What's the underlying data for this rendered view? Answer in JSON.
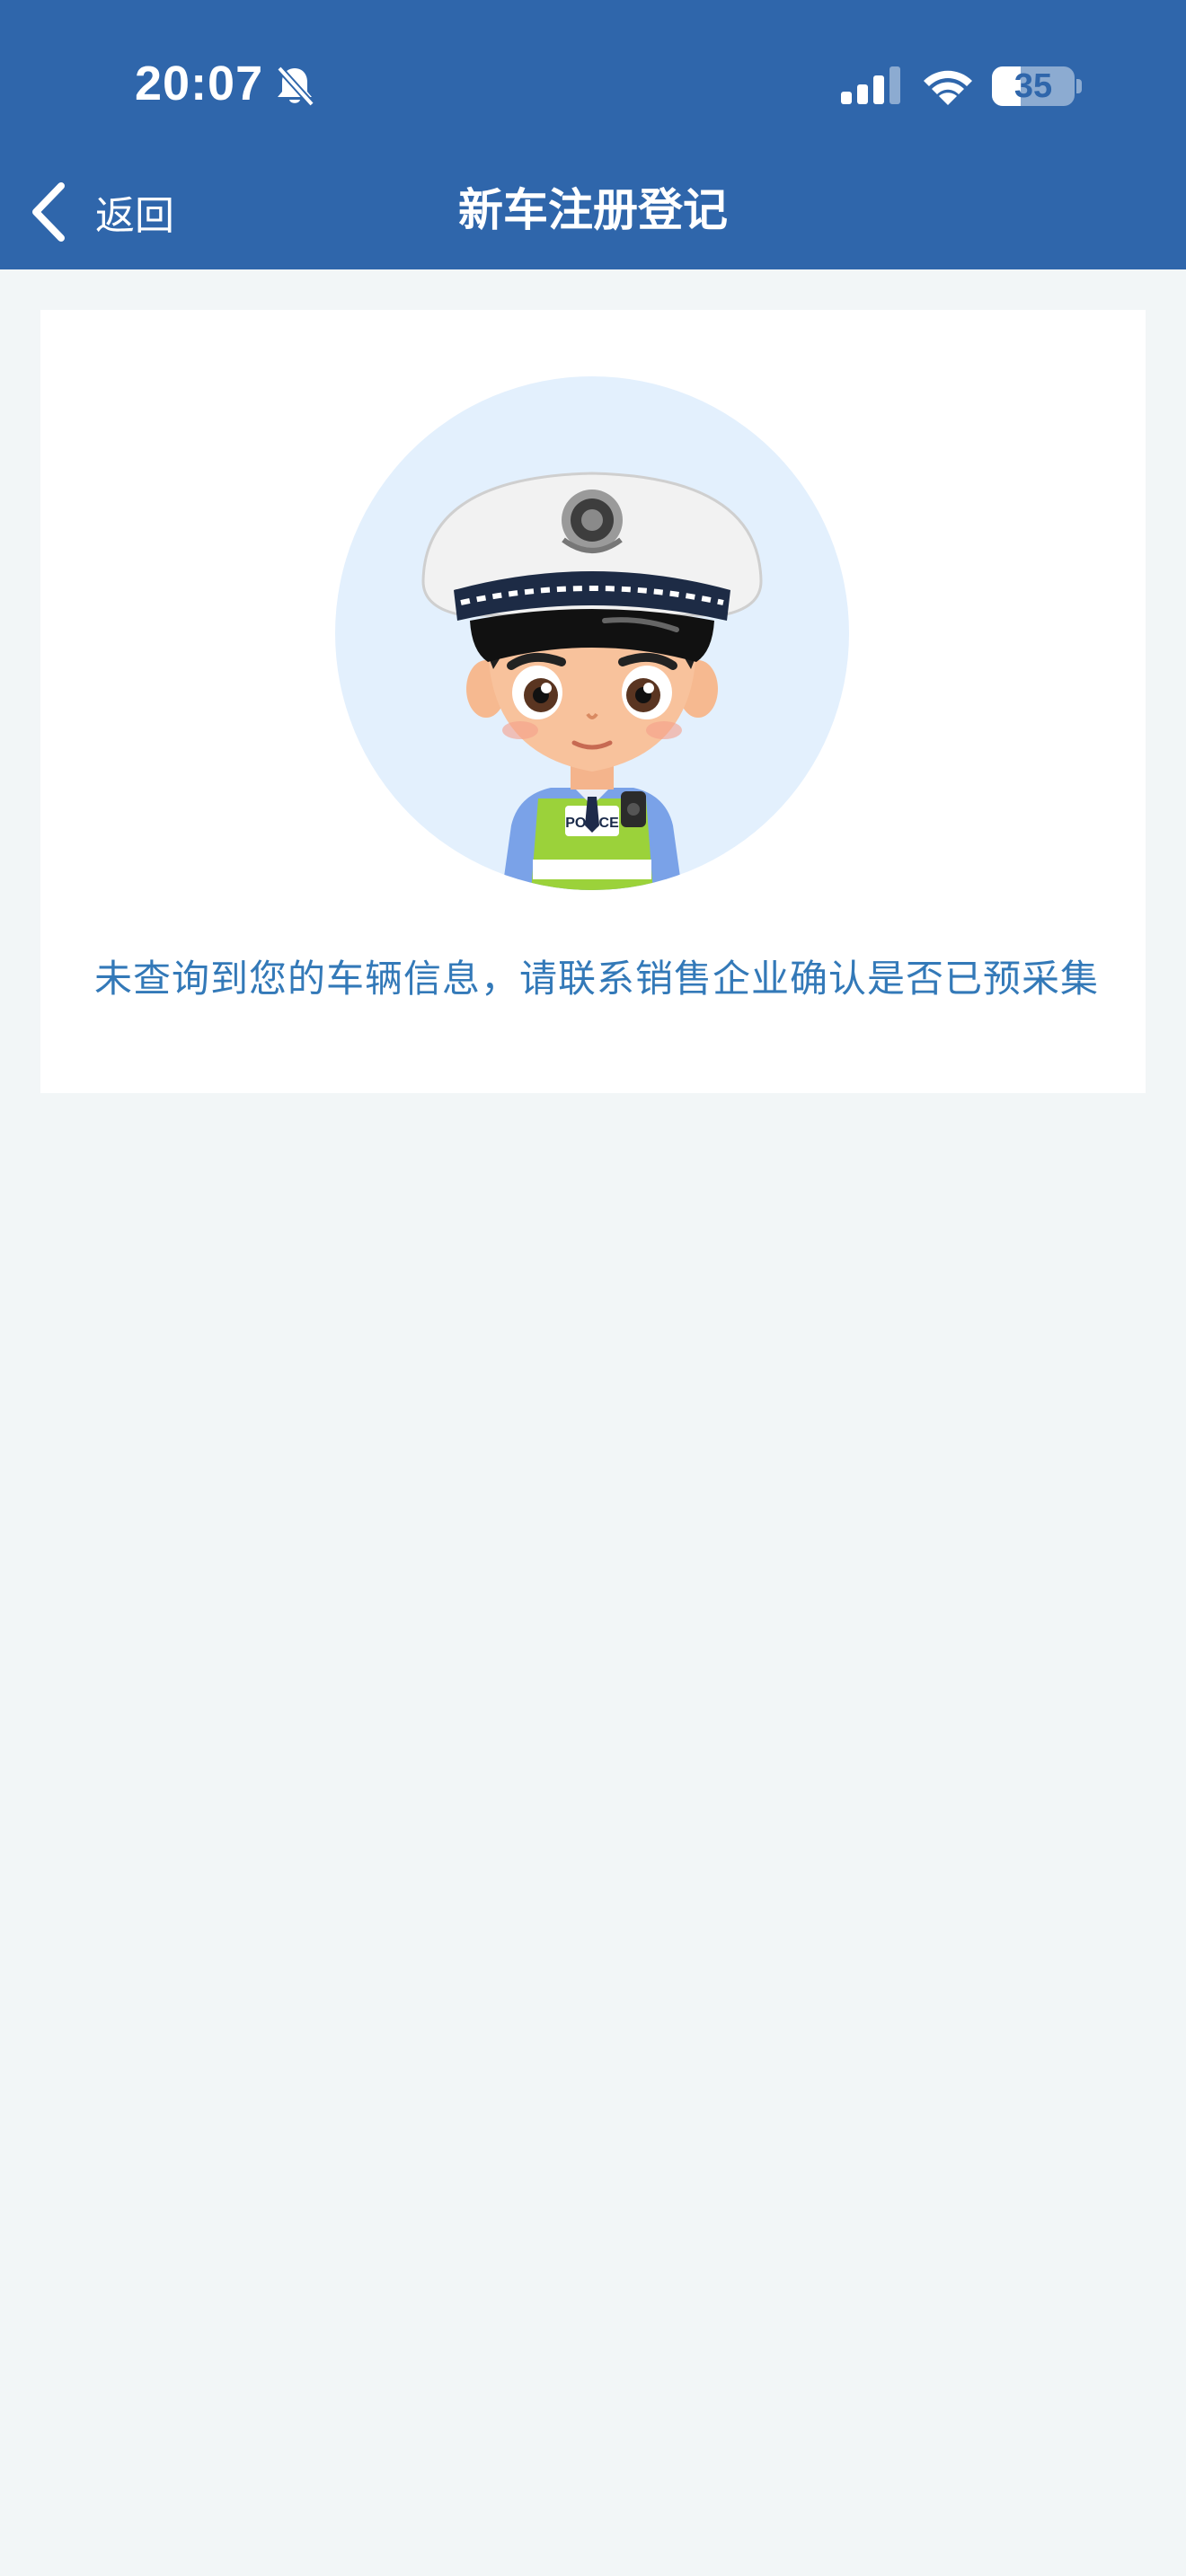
{
  "status_bar": {
    "time": "20:07",
    "battery": "35",
    "battery_level": 0.35,
    "icons": [
      "bell-slash-icon",
      "cellular-signal-icon",
      "wifi-icon",
      "battery-icon"
    ]
  },
  "nav": {
    "back_label": "返回",
    "title": "新车注册登记"
  },
  "main": {
    "message": "未查询到您的车辆信息，请联系销售企业确认是否已预采集",
    "badge_text": "POLICE"
  },
  "colors": {
    "header_bg": "#2f66ab",
    "page_bg": "#f2f6f7",
    "card_bg": "#ffffff",
    "message_text": "#3379b8",
    "avatar_circle": "#e3f0fd"
  }
}
